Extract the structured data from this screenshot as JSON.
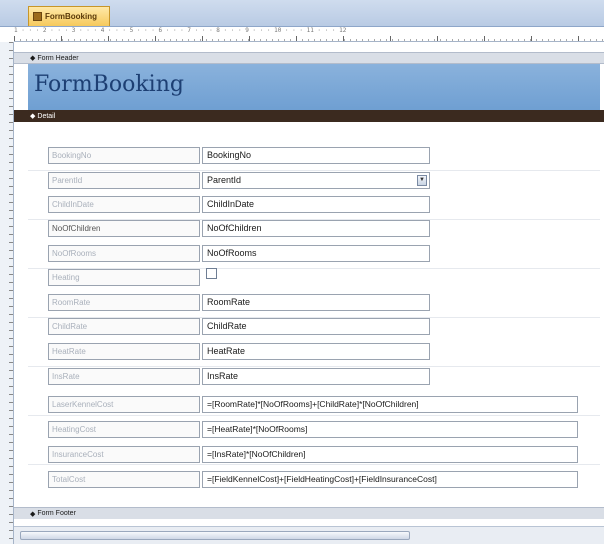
{
  "window": {
    "tab_title": "FormBooking"
  },
  "sections": {
    "header": "Form Header",
    "detail": "Detail",
    "footer": "Form Footer"
  },
  "form": {
    "title": "FormBooking"
  },
  "fields": [
    {
      "label": "BookingNo",
      "value": "BookingNo",
      "type": "text"
    },
    {
      "label": "ParentId",
      "value": "ParentId",
      "type": "combo"
    },
    {
      "label": "ChildInDate",
      "value": "ChildInDate",
      "type": "text"
    },
    {
      "label": "NoOfChildren",
      "value": "NoOfChildren",
      "type": "text"
    },
    {
      "label": "NoOfRooms",
      "value": "NoOfRooms",
      "type": "text"
    },
    {
      "label": "Heating",
      "value": "",
      "type": "checkbox"
    },
    {
      "label": "RoomRate",
      "value": "RoomRate",
      "type": "text"
    },
    {
      "label": "ChildRate",
      "value": "ChildRate",
      "type": "text"
    },
    {
      "label": "HeatRate",
      "value": "HeatRate",
      "type": "text"
    },
    {
      "label": "InsRate",
      "value": "InsRate",
      "type": "text"
    }
  ],
  "calculated": [
    {
      "label": "LaserKennelCost",
      "expression": "=[RoomRate]*[NoOfRooms]+[ChildRate]*[NoOfChildren]"
    },
    {
      "label": "HeatingCost",
      "expression": "=[HeatRate]*[NoOfRooms]"
    },
    {
      "label": "InsuranceCost",
      "expression": "=[InsRate]*[NoOfChildren]"
    },
    {
      "label": "TotalCost",
      "expression": "=[FieldKennelCost]+[FieldHeatingCost]+[FieldInsuranceCost]"
    }
  ],
  "ruler": {
    "numbers": "1 · · · 2 · · · 3 · · · 4 · · · 5 · · · 6 · · · 7 · · · 8 · · · 9 · · · 10 · · · 11 · · · 12"
  },
  "colors": {
    "header_band": "#7fa8d6",
    "title_text": "#1d3f73",
    "detail_bar": "#3b2a1f",
    "tab_active": "#f6c95c"
  }
}
